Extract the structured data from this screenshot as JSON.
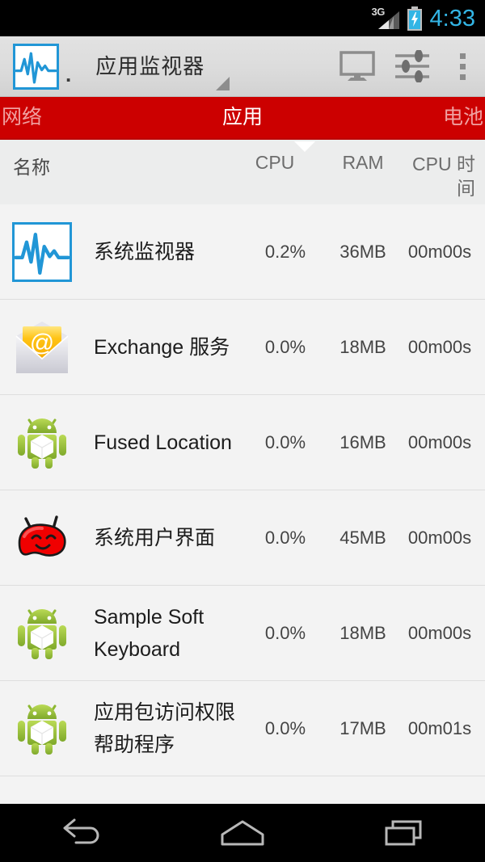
{
  "status_bar": {
    "network_type": "3G",
    "signal_icon": "signal-bars-icon",
    "battery_icon": "battery-charging-icon",
    "time": "4:33",
    "clock_color": "#33b5e5"
  },
  "action_bar": {
    "logo_icon": "app-waveform-logo",
    "logo_suffix": ".",
    "title": "应用监视器",
    "dropdown_icon": "dropdown-triangle-icon",
    "actions": [
      {
        "name": "monitor-icon",
        "label": "显示器"
      },
      {
        "name": "sliders-icon",
        "label": "设置"
      },
      {
        "name": "overflow-menu-icon",
        "label": "更多选项"
      }
    ]
  },
  "tabs": {
    "accent_color": "#cc0000",
    "active_color": "#ffffff",
    "inactive_color": "#f0a0a0",
    "items": [
      {
        "label": "网络",
        "active": false
      },
      {
        "label": "应用",
        "active": true
      },
      {
        "label": "电池",
        "active": false
      }
    ]
  },
  "column_headers": {
    "name": "名称",
    "cpu": "CPU",
    "ram": "RAM",
    "cpu_time": "CPU 时间",
    "sort_column": "CPU",
    "sort_icon": "sort-descending-triangle-icon"
  },
  "rows": [
    {
      "icon": "system-monitor-icon",
      "name": "系统监视器",
      "cpu": "0.2%",
      "ram": "36MB",
      "cpu_time": "00m00s"
    },
    {
      "icon": "email-envelope-icon",
      "name": "Exchange 服务",
      "cpu": "0.0%",
      "ram": "18MB",
      "cpu_time": "00m00s"
    },
    {
      "icon": "android-robot-icon",
      "name": "Fused Location",
      "cpu": "0.0%",
      "ram": "16MB",
      "cpu_time": "00m00s"
    },
    {
      "icon": "jellybean-icon",
      "name": "系统用户界面",
      "cpu": "0.0%",
      "ram": "45MB",
      "cpu_time": "00m00s"
    },
    {
      "icon": "android-robot-icon",
      "name": "Sample Soft Keyboard",
      "cpu": "0.0%",
      "ram": "18MB",
      "cpu_time": "00m00s"
    },
    {
      "icon": "android-robot-icon",
      "name": "应用包访问权限帮助程序",
      "cpu": "0.0%",
      "ram": "17MB",
      "cpu_time": "00m01s"
    }
  ],
  "nav_bar": {
    "back": "back-icon",
    "home": "home-icon",
    "recents": "recents-icon"
  }
}
